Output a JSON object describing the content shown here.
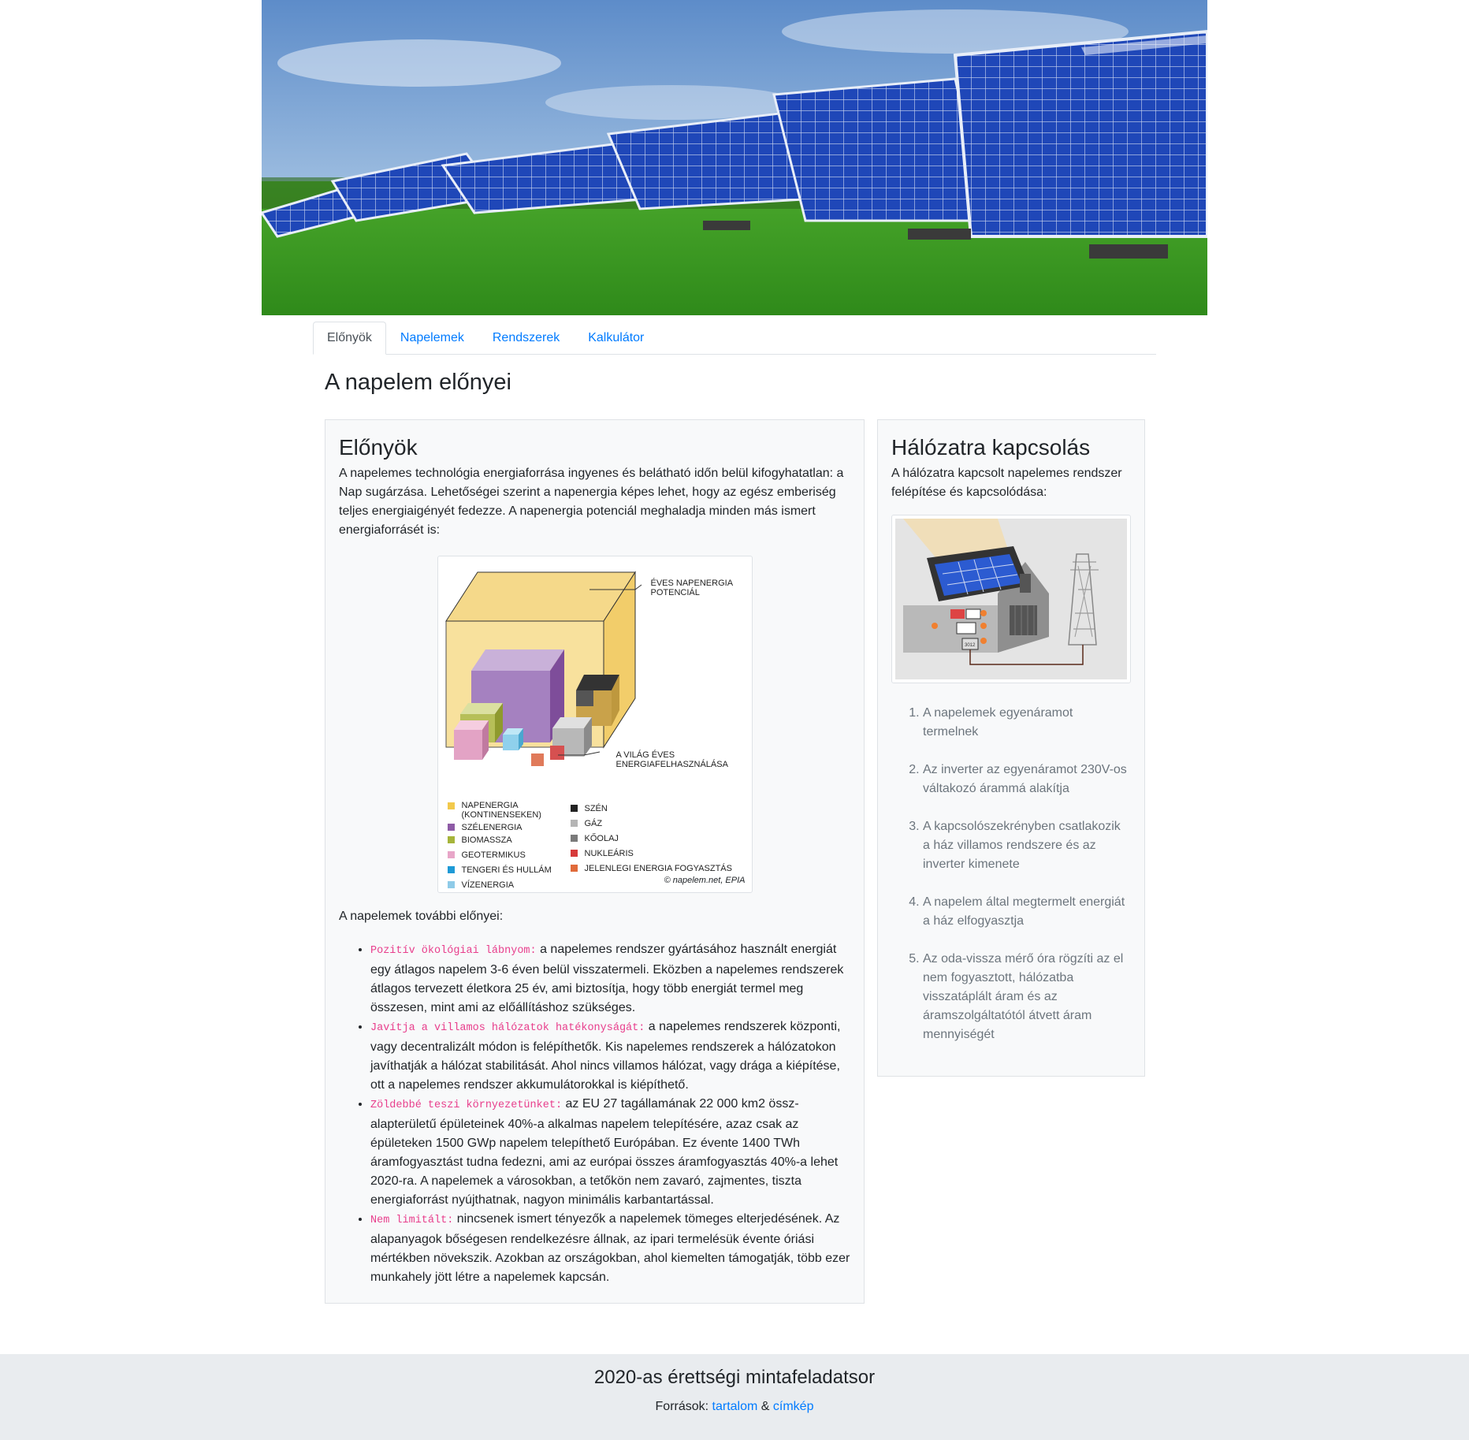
{
  "hero": {
    "image": "solar-panels-field-image"
  },
  "nav": {
    "tabs": [
      {
        "label": "Előnyök",
        "active": true
      },
      {
        "label": "Napelemek",
        "active": false
      },
      {
        "label": "Rendszerek",
        "active": false
      },
      {
        "label": "Kalkulátor",
        "active": false
      }
    ]
  },
  "page_title": "A napelem előnyei",
  "main": {
    "heading": "Előnyök",
    "intro": "A napelemes technológia energiaforrása ingyenes és belátható időn belül kifogyhatatlan: a Nap sugárzása. Lehetőségei szerint a napenergia képes lehet, hogy az egész emberiség teljes energiaigényét fedezze. A napenergia potenciál meghaladja minden más ismert energiaforrásét is:",
    "figure": {
      "label_potential": "ÉVES NAPENERGIA POTENCIÁL",
      "label_world": "A VILÁG ÉVES ENERGIAFELHASZNÁLÁSA",
      "legend_left": [
        {
          "label": "NAPENERGIA (KONTINENSEKEN)",
          "color": "#f2c94c"
        },
        {
          "label": "SZÉLENERGIA",
          "color": "#8e5ba6"
        },
        {
          "label": "BIOMASSZA",
          "color": "#a6b43a"
        },
        {
          "label": "GEOTERMIKUS",
          "color": "#e8a6c8"
        },
        {
          "label": "TENGERI ÉS HULLÁM",
          "color": "#1e9ad6"
        },
        {
          "label": "VÍZENERGIA",
          "color": "#8fcbe8"
        }
      ],
      "legend_right": [
        {
          "label": "SZÉN",
          "color": "#222222"
        },
        {
          "label": "GÁZ",
          "color": "#b5b5b5"
        },
        {
          "label": "KŐOLAJ",
          "color": "#7a7a7a"
        },
        {
          "label": "NUKLEÁRIS",
          "color": "#d63a3a"
        },
        {
          "label": "JELENLEGI ENERGIA FOGYASZTÁS",
          "color": "#e06a3a"
        }
      ],
      "copyright": "© napelem.net, EPIA"
    },
    "more_title": "A napelemek további előnyei:",
    "advantages": [
      {
        "term": "Pozitív ökológiai lábnyom:",
        "text": " a napelemes rendszer gyártásához használt energiát egy átlagos napelem 3-6 éven belül visszatermeli. Eközben a napelemes rendszerek átlagos tervezett életkora 25 év, ami biztosítja, hogy több energiát termel meg összesen, mint ami az előállításhoz szükséges."
      },
      {
        "term": "Javítja a villamos hálózatok hatékonyságát:",
        "text": " a napelemes rendszerek központi, vagy decentralizált módon is felépíthetők. Kis napelemes rendszerek a hálózatokon javíthatják a hálózat stabilitását. Ahol nincs villamos hálózat, vagy drága a kiépítése, ott a napelemes rendszer akkumulátorokkal is kiépíthető."
      },
      {
        "term": "Zöldebbé teszi környezetünket:",
        "text": " az EU 27 tagállamának 22 000 km2 össz-alapterületű épületeinek 40%-a alkalmas napelem telepítésére, azaz csak az épületeken 1500 GWp napelem telepíthető Európában. Ez évente 1400 TWh áramfogyasztást tudna fedezni, ami az európai összes áramfogyasztás 40%-a lehet 2020-ra. A napelemek a városokban, a tetőkön nem zavaró, zajmentes, tiszta energiaforrást nyújthatnak, nagyon minimális karbantartással."
      },
      {
        "term": "Nem limitált:",
        "text": " nincsenek ismert tényezők a napelemek tömeges elterjedésének. Az alapanyagok bőségesen rendelkezésre állnak, az ipari termelésük évente óriási mértékben növekszik. Azokban az országokban, ahol kiemelten támogatják, több ezer munkahely jött létre a napelemek kapcsán."
      }
    ]
  },
  "side": {
    "heading": "Hálózatra kapcsolás",
    "intro": "A hálózatra kapcsolt napelemes rendszer felépítése és kapcsolódása:",
    "diagram_meter": "3012",
    "steps": [
      "A napelemek egyenáramot termelnek",
      "Az inverter az egyenáramot 230V-os váltakozó árammá alakítja",
      "A kapcsolószekrényben csatlakozik a ház villamos rendszere és az inverter kimenete",
      "A napelem által megtermelt energiát a ház elfogyasztja",
      "Az oda-vissza mérő óra rögzíti az el nem fogyasztott, hálózatba visszatáplált áram és az áramszolgáltatótól átvett áram mennyiségét"
    ]
  },
  "footer": {
    "title": "2020-as érettségi mintafeladatsor",
    "sources_prefix": "Források: ",
    "link_content": "tartalom",
    "amp": " & ",
    "link_image": "címkép"
  }
}
